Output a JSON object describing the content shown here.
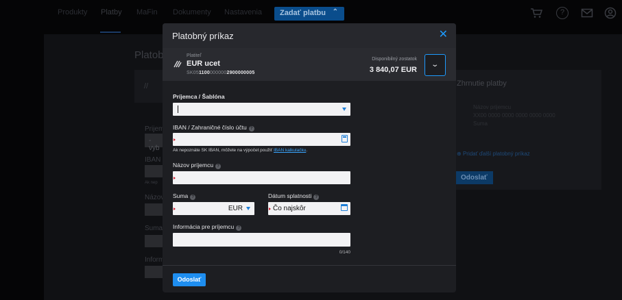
{
  "nav": {
    "items": [
      "Produkty",
      "Platby",
      "MaFin",
      "Dokumenty",
      "Nastavenia"
    ],
    "cta_label": "Zadať platbu"
  },
  "background": {
    "page_title": "Platob",
    "summary_title": "Zhrnutie platby",
    "summary_name": "Názov prijemcu",
    "summary_iban": "XX00 0000 0000 0000 0000 0000",
    "summary_amount": "Suma",
    "add_payment": "Pridať ďalší platobný príkaz",
    "send_label": "Odoslať",
    "select_placeholder": "- vyb",
    "lbl_prijem": "Prijem",
    "lbl_iban": "IBAN /",
    "lbl_ak": "Ak nep",
    "lbl_nazov": "Názov",
    "lbl_suma": "Suma",
    "lbl_inform": "Inform"
  },
  "modal": {
    "title": "Platobný príkaz",
    "payer": {
      "label": "Platiteľ",
      "name": "EUR ucet",
      "iban_prefix": "SK05",
      "iban_bold1": "1100",
      "iban_mid": "000000",
      "iban_bold2": "2900000005",
      "balance_label": "Disponibilný zostatok",
      "balance_value": "3 840,07 EUR"
    },
    "fields": {
      "recipient_label": "Príjemca / Šablóna",
      "iban_label": "IBAN / Zahraničné číslo účtu",
      "iban_hint": "Ak nepoznáte SK IBAN, môžete na výpočet použiť",
      "iban_hint_link": "IBAN kalkulačku",
      "iban_hint_end": ".",
      "name_label": "Názov príjemcu",
      "amount_label": "Suma",
      "currency": "EUR",
      "due_date_label": "Dátum splatnosti",
      "due_date_value": "Čo najskôr",
      "info_label": "Informácia pre príjemcu",
      "info_counter": "0/140"
    },
    "send_label": "Odoslať"
  },
  "colors": {
    "accent": "#1e9bff",
    "required": "#d11b2d"
  }
}
